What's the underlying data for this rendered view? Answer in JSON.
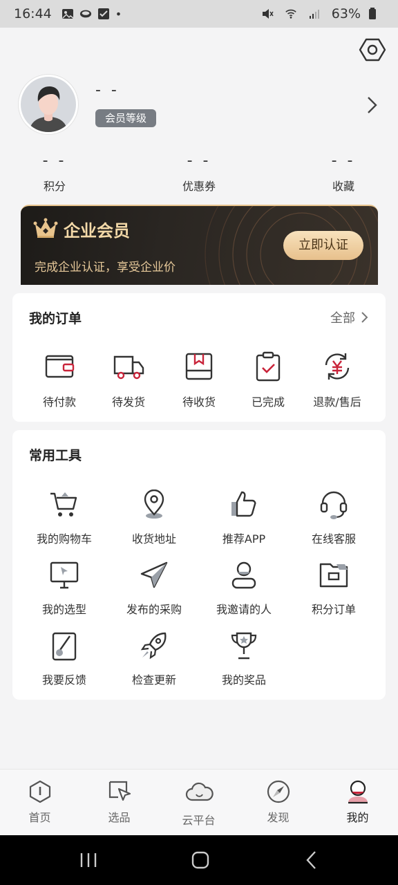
{
  "status_bar": {
    "time": "16:44",
    "dot": "•",
    "battery": "63%"
  },
  "profile": {
    "name": "- -",
    "level_badge": "会员等级"
  },
  "stats": [
    {
      "value": "- -",
      "label": "积分"
    },
    {
      "value": "- -",
      "label": "优惠券"
    },
    {
      "value": "- -",
      "label": "收藏"
    }
  ],
  "vip_banner": {
    "title": "企业会员",
    "subtitle": "完成企业认证，享受企业价",
    "button": "立即认证"
  },
  "orders": {
    "title": "我的订单",
    "all_label": "全部",
    "items": [
      {
        "label": "待付款",
        "icon": "wallet-icon"
      },
      {
        "label": "待发货",
        "icon": "truck-icon"
      },
      {
        "label": "待收货",
        "icon": "package-icon"
      },
      {
        "label": "已完成",
        "icon": "clipboard-check-icon"
      },
      {
        "label": "退款/售后",
        "icon": "refund-icon"
      }
    ]
  },
  "tools": {
    "title": "常用工具",
    "items": [
      {
        "label": "我的购物车",
        "icon": "cart-icon"
      },
      {
        "label": "收货地址",
        "icon": "location-pin-icon"
      },
      {
        "label": "推荐APP",
        "icon": "thumbs-up-icon"
      },
      {
        "label": "在线客服",
        "icon": "headset-icon"
      },
      {
        "label": "我的选型",
        "icon": "monitor-cursor-icon"
      },
      {
        "label": "发布的采购",
        "icon": "paper-plane-icon"
      },
      {
        "label": "我邀请的人",
        "icon": "person-icon"
      },
      {
        "label": "积分订单",
        "icon": "folder-icon"
      },
      {
        "label": "我要反馈",
        "icon": "feedback-pen-icon"
      },
      {
        "label": "检查更新",
        "icon": "rocket-icon"
      },
      {
        "label": "我的奖品",
        "icon": "trophy-icon"
      }
    ]
  },
  "tabbar": {
    "items": [
      {
        "label": "首页",
        "icon": "home-icon"
      },
      {
        "label": "选品",
        "icon": "select-cursor-icon"
      },
      {
        "label": "云平台",
        "icon": "cloud-icon"
      },
      {
        "label": "发现",
        "icon": "compass-icon"
      },
      {
        "label": "我的",
        "icon": "profile-icon",
        "active": true
      }
    ]
  },
  "colors": {
    "accent": "#c9243a",
    "gold": "#e8c48d",
    "vip_dark": "#1d1b18"
  }
}
